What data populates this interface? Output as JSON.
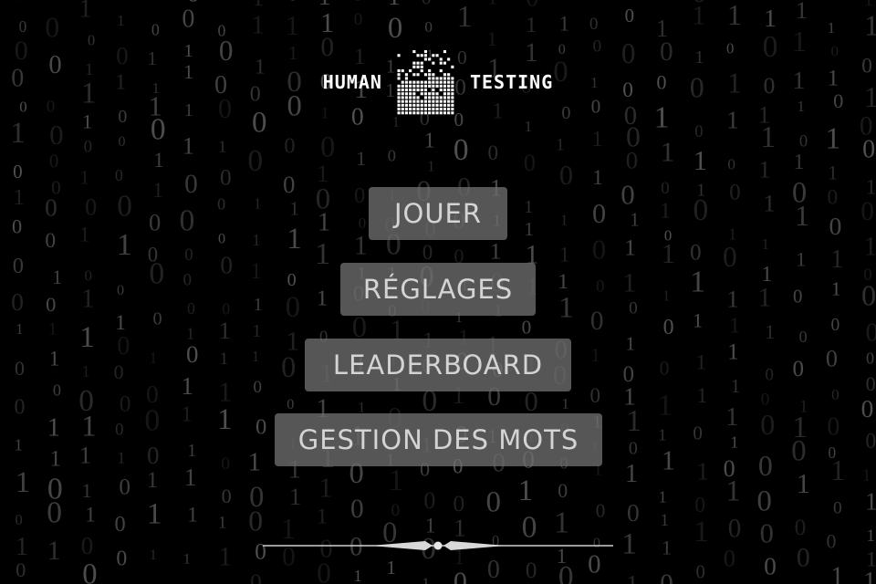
{
  "logo": {
    "left_word": "HUMAN",
    "right_word": "TESTING",
    "mark_icon": "pixel-dissolve-icon"
  },
  "menu": {
    "items": [
      {
        "label": "JOUER"
      },
      {
        "label": "RÉGLAGES"
      },
      {
        "label": "LEADERBOARD"
      },
      {
        "label": "GESTION DES MOTS"
      }
    ]
  },
  "divider": {
    "icon": "ornamental-divider-icon"
  },
  "background": {
    "style": "binary-digit-rain"
  },
  "colors": {
    "background": "#000000",
    "button": "#6e6e6e",
    "button_text": "#f0f0f0",
    "logo_text": "#ffffff"
  }
}
